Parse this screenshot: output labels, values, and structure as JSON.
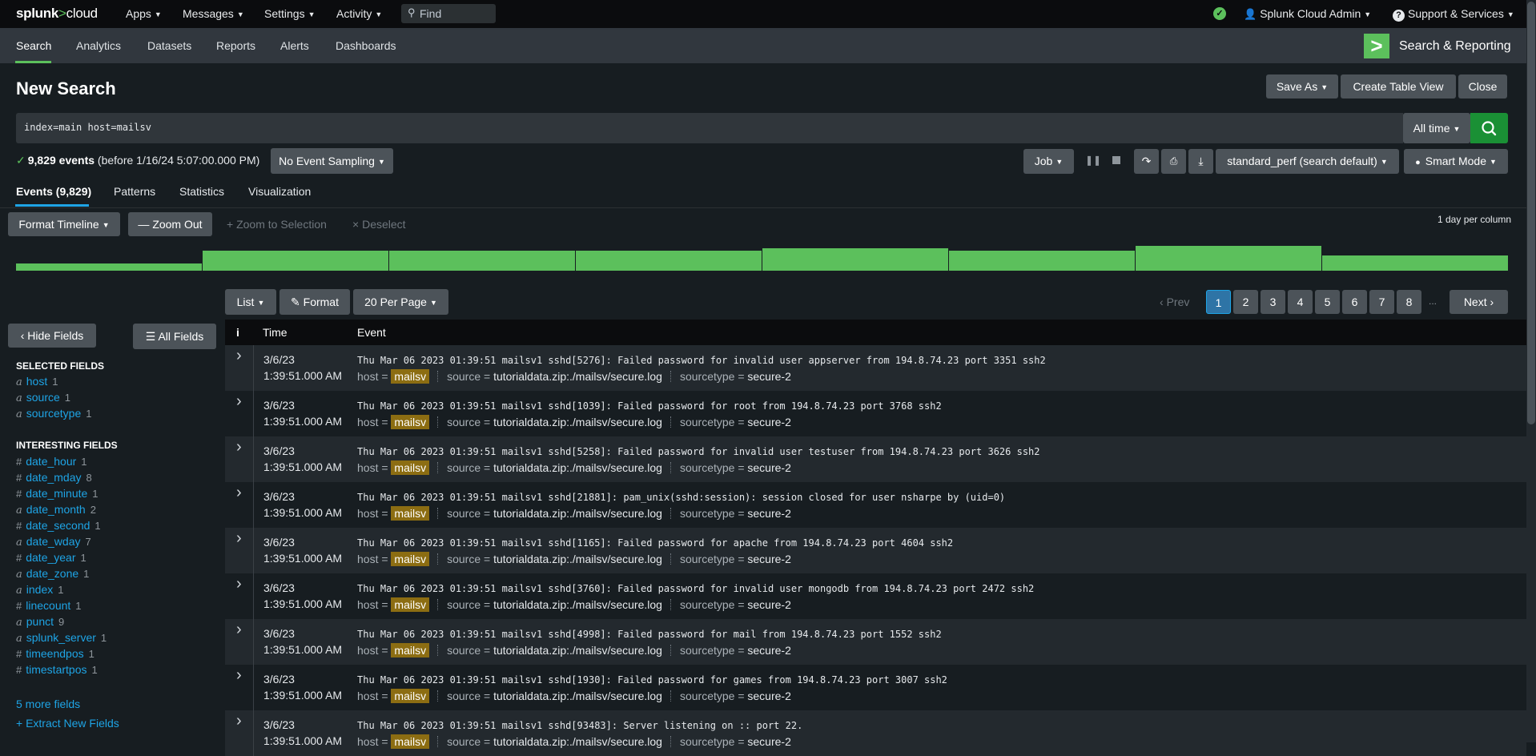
{
  "topbar": {
    "logo_brand": "splunk",
    "logo_sep": ">",
    "logo_product": "cloud",
    "menus": [
      "Apps",
      "Messages",
      "Settings",
      "Activity"
    ],
    "find_placeholder": "Find",
    "user": "Splunk Cloud Admin",
    "support": "Support & Services"
  },
  "appnav": {
    "items": [
      "Search",
      "Analytics",
      "Datasets",
      "Reports",
      "Alerts",
      "Dashboards"
    ],
    "app_title": "Search & Reporting",
    "active": "Search"
  },
  "header": {
    "title": "New Search",
    "save_as": "Save As",
    "create_table": "Create Table View",
    "close": "Close"
  },
  "search": {
    "query": "index=main host=mailsv",
    "time_range": "All time"
  },
  "meta": {
    "events_count": "9,829 events",
    "before": "(before 1/16/24 5:07:00.000 PM)",
    "sampling": "No Event Sampling",
    "job": "Job",
    "perf": "standard_perf (search default)",
    "mode": "Smart Mode"
  },
  "result_tabs": [
    "Events (9,829)",
    "Patterns",
    "Statistics",
    "Visualization"
  ],
  "timeline": {
    "format": "Format Timeline",
    "zoom_out": "Zoom Out",
    "zoom_sel": "Zoom to Selection",
    "deselect": "Deselect",
    "per_column": "1 day per column",
    "bar_levels": [
      0.27,
      0.73,
      0.73,
      0.73,
      0.82,
      0.73,
      0.91,
      0.55
    ]
  },
  "fields_panel": {
    "hide_fields": "Hide Fields",
    "all_fields": "All Fields",
    "selected_heading": "SELECTED FIELDS",
    "selected": [
      {
        "type": "a",
        "name": "host",
        "count": "1"
      },
      {
        "type": "a",
        "name": "source",
        "count": "1"
      },
      {
        "type": "a",
        "name": "sourcetype",
        "count": "1"
      }
    ],
    "interesting_heading": "INTERESTING FIELDS",
    "interesting": [
      {
        "type": "#",
        "name": "date_hour",
        "count": "1"
      },
      {
        "type": "#",
        "name": "date_mday",
        "count": "8"
      },
      {
        "type": "#",
        "name": "date_minute",
        "count": "1"
      },
      {
        "type": "a",
        "name": "date_month",
        "count": "2"
      },
      {
        "type": "#",
        "name": "date_second",
        "count": "1"
      },
      {
        "type": "a",
        "name": "date_wday",
        "count": "7"
      },
      {
        "type": "#",
        "name": "date_year",
        "count": "1"
      },
      {
        "type": "a",
        "name": "date_zone",
        "count": "1"
      },
      {
        "type": "a",
        "name": "index",
        "count": "1"
      },
      {
        "type": "#",
        "name": "linecount",
        "count": "1"
      },
      {
        "type": "a",
        "name": "punct",
        "count": "9"
      },
      {
        "type": "a",
        "name": "splunk_server",
        "count": "1"
      },
      {
        "type": "#",
        "name": "timeendpos",
        "count": "1"
      },
      {
        "type": "#",
        "name": "timestartpos",
        "count": "1"
      }
    ],
    "more_fields": "5 more fields",
    "extract": "+ Extract New Fields"
  },
  "results_controls": {
    "list": "List",
    "format": "Format",
    "per_page": "20 Per Page",
    "prev": "Prev",
    "pages": [
      "1",
      "2",
      "3",
      "4",
      "5",
      "6",
      "7",
      "8"
    ],
    "ellipsis": "...",
    "next": "Next"
  },
  "table": {
    "col_info": "i",
    "col_time": "Time",
    "col_event": "Event",
    "rows": [
      {
        "date": "3/6/23",
        "time": "1:39:51.000 AM",
        "event": "Thu Mar 06 2023 01:39:51 mailsv1 sshd[5276]: Failed password for invalid user appserver from 194.8.74.23 port 3351 ssh2",
        "host": "mailsv",
        "source": "tutorialdata.zip:./mailsv/secure.log",
        "sourcetype": "secure-2"
      },
      {
        "date": "3/6/23",
        "time": "1:39:51.000 AM",
        "event": "Thu Mar 06 2023 01:39:51 mailsv1 sshd[1039]: Failed password for root from 194.8.74.23 port 3768 ssh2",
        "host": "mailsv",
        "source": "tutorialdata.zip:./mailsv/secure.log",
        "sourcetype": "secure-2"
      },
      {
        "date": "3/6/23",
        "time": "1:39:51.000 AM",
        "event": "Thu Mar 06 2023 01:39:51 mailsv1 sshd[5258]: Failed password for invalid user testuser from 194.8.74.23 port 3626 ssh2",
        "host": "mailsv",
        "source": "tutorialdata.zip:./mailsv/secure.log",
        "sourcetype": "secure-2"
      },
      {
        "date": "3/6/23",
        "time": "1:39:51.000 AM",
        "event": "Thu Mar 06 2023 01:39:51 mailsv1 sshd[21881]: pam_unix(sshd:session): session closed for user nsharpe by (uid=0)",
        "host": "mailsv",
        "source": "tutorialdata.zip:./mailsv/secure.log",
        "sourcetype": "secure-2"
      },
      {
        "date": "3/6/23",
        "time": "1:39:51.000 AM",
        "event": "Thu Mar 06 2023 01:39:51 mailsv1 sshd[1165]: Failed password for apache from 194.8.74.23 port 4604 ssh2",
        "host": "mailsv",
        "source": "tutorialdata.zip:./mailsv/secure.log",
        "sourcetype": "secure-2"
      },
      {
        "date": "3/6/23",
        "time": "1:39:51.000 AM",
        "event": "Thu Mar 06 2023 01:39:51 mailsv1 sshd[3760]: Failed password for invalid user mongodb from 194.8.74.23 port 2472 ssh2",
        "host": "mailsv",
        "source": "tutorialdata.zip:./mailsv/secure.log",
        "sourcetype": "secure-2"
      },
      {
        "date": "3/6/23",
        "time": "1:39:51.000 AM",
        "event": "Thu Mar 06 2023 01:39:51 mailsv1 sshd[4998]: Failed password for mail from 194.8.74.23 port 1552 ssh2",
        "host": "mailsv",
        "source": "tutorialdata.zip:./mailsv/secure.log",
        "sourcetype": "secure-2"
      },
      {
        "date": "3/6/23",
        "time": "1:39:51.000 AM",
        "event": "Thu Mar 06 2023 01:39:51 mailsv1 sshd[1930]: Failed password for games from 194.8.74.23 port 3007 ssh2",
        "host": "mailsv",
        "source": "tutorialdata.zip:./mailsv/secure.log",
        "sourcetype": "secure-2"
      },
      {
        "date": "3/6/23",
        "time": "1:39:51.000 AM",
        "event": "Thu Mar 06 2023 01:39:51 mailsv1 sshd[93483]: Server listening on :: port 22.",
        "host": "mailsv",
        "source": "tutorialdata.zip:./mailsv/secure.log",
        "sourcetype": "secure-2"
      }
    ]
  },
  "colors": {
    "accent_green": "#5cc05c",
    "search_button": "#1a9035",
    "link_blue": "#1ea4e5",
    "host_highlight": "#8c6d12",
    "background": "#171d21"
  }
}
